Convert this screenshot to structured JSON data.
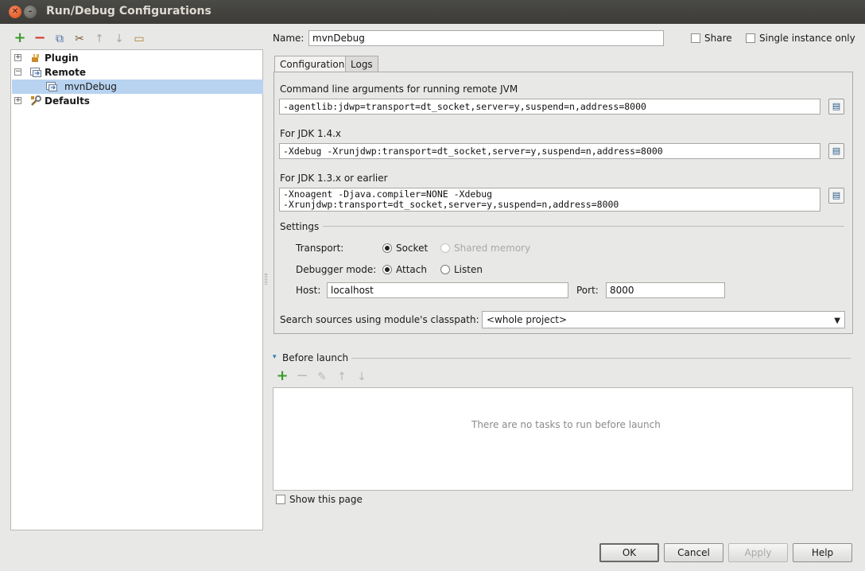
{
  "window": {
    "title": "Run/Debug Configurations",
    "close_glyph": "✕",
    "minimize_glyph": "–"
  },
  "toolbar": {
    "add": "+",
    "remove": "−",
    "copy": "⧉",
    "edit_defaults": "✂",
    "move_up": "↑",
    "move_down": "↓",
    "folder": "▭"
  },
  "tree": {
    "items": [
      {
        "label": "Plugin",
        "expander": "+"
      },
      {
        "label": "Remote",
        "expander": "−"
      },
      {
        "label": "mvnDebug"
      },
      {
        "label": "Defaults",
        "expander": "+"
      }
    ]
  },
  "header": {
    "name_label": "Name:",
    "name_value": "mvnDebug",
    "share_label": "Share",
    "single_instance_label": "Single instance only"
  },
  "tabs": [
    {
      "label": "Configuration",
      "active": true
    },
    {
      "label": "Logs",
      "active": false
    }
  ],
  "config": {
    "cmd_label": "Command line arguments for running remote JVM",
    "cmd_value": "-agentlib:jdwp=transport=dt_socket,server=y,suspend=n,address=8000",
    "jdk14_label": "For JDK 1.4.x",
    "jdk14_value": "-Xdebug -Xrunjdwp:transport=dt_socket,server=y,suspend=n,address=8000",
    "jdk13_label": "For JDK 1.3.x or earlier",
    "jdk13_line1": "-Xnoagent -Djava.compiler=NONE -Xdebug",
    "jdk13_line2": "-Xrunjdwp:transport=dt_socket,server=y,suspend=n,address=8000",
    "copy_glyph": "▤",
    "settings_label": "Settings",
    "transport_label": "Transport:",
    "transport_options": [
      "Socket",
      "Shared memory"
    ],
    "transport_selected": "Socket",
    "debugger_mode_label": "Debugger mode:",
    "debugger_mode_options": [
      "Attach",
      "Listen"
    ],
    "debugger_mode_selected": "Attach",
    "host_label": "Host:",
    "host_value": "localhost",
    "port_label": "Port:",
    "port_value": "8000",
    "classpath_label": "Search sources using module's classpath:",
    "classpath_value": "<whole project>",
    "dropdown_arrow": "▼"
  },
  "before_launch": {
    "label": "Before launch",
    "collapse_glyph": "▾",
    "add": "+",
    "remove": "−",
    "edit": "✎",
    "up": "↑",
    "down": "↓",
    "empty_text": "There are no tasks to run before launch",
    "show_page_label": "Show this page"
  },
  "buttons": {
    "ok": "OK",
    "cancel": "Cancel",
    "apply": "Apply",
    "help": "Help"
  },
  "colors": {
    "add_green": "#3a9a2a",
    "remove_red": "#d2382a",
    "selection": "#b8d3f0"
  }
}
